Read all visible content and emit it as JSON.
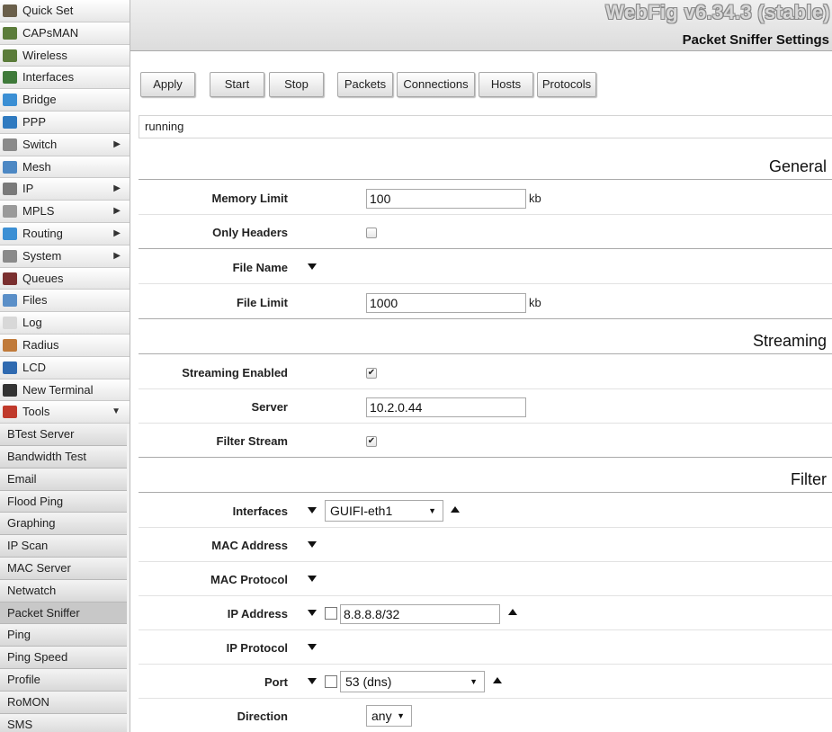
{
  "sidebar": {
    "items": [
      {
        "label": "Quick Set",
        "icon": "quick-set-icon",
        "color": "#6a5f4a",
        "arrow": ""
      },
      {
        "label": "CAPsMAN",
        "icon": "antenna-icon",
        "color": "#5b7c3a",
        "arrow": ""
      },
      {
        "label": "Wireless",
        "icon": "antenna-icon",
        "color": "#5b7c3a",
        "arrow": ""
      },
      {
        "label": "Interfaces",
        "icon": "interfaces-icon",
        "color": "#3f7a3a",
        "arrow": ""
      },
      {
        "label": "Bridge",
        "icon": "bridge-icon",
        "color": "#3b8fd4",
        "arrow": ""
      },
      {
        "label": "PPP",
        "icon": "ppp-icon",
        "color": "#2f7ac0",
        "arrow": ""
      },
      {
        "label": "Switch",
        "icon": "switch-icon",
        "color": "#8a8a8a",
        "arrow": "▶"
      },
      {
        "label": "Mesh",
        "icon": "mesh-icon",
        "color": "#4d88c4",
        "arrow": ""
      },
      {
        "label": "IP",
        "icon": "ip-icon",
        "color": "#7a7a7a",
        "arrow": "▶"
      },
      {
        "label": "MPLS",
        "icon": "mpls-icon",
        "color": "#9a9a9a",
        "arrow": "▶"
      },
      {
        "label": "Routing",
        "icon": "routing-icon",
        "color": "#3b8fd4",
        "arrow": "▶"
      },
      {
        "label": "System",
        "icon": "gear-icon",
        "color": "#8a8a8a",
        "arrow": "▶"
      },
      {
        "label": "Queues",
        "icon": "queues-icon",
        "color": "#7a2f2f",
        "arrow": ""
      },
      {
        "label": "Files",
        "icon": "folder-icon",
        "color": "#5a8fc8",
        "arrow": ""
      },
      {
        "label": "Log",
        "icon": "log-icon",
        "color": "#d8d8d8",
        "arrow": ""
      },
      {
        "label": "Radius",
        "icon": "radius-icon",
        "color": "#c07a3a",
        "arrow": ""
      },
      {
        "label": "LCD",
        "icon": "monitor-icon",
        "color": "#2f6ab0",
        "arrow": ""
      },
      {
        "label": "New Terminal",
        "icon": "terminal-icon",
        "color": "#333333",
        "arrow": ""
      },
      {
        "label": "Tools",
        "icon": "tools-icon",
        "color": "#c0392b",
        "arrow": "▼"
      }
    ],
    "tools_submenu": [
      {
        "label": "BTest Server",
        "active": false
      },
      {
        "label": "Bandwidth Test",
        "active": false
      },
      {
        "label": "Email",
        "active": false
      },
      {
        "label": "Flood Ping",
        "active": false
      },
      {
        "label": "Graphing",
        "active": false
      },
      {
        "label": "IP Scan",
        "active": false
      },
      {
        "label": "MAC Server",
        "active": false
      },
      {
        "label": "Netwatch",
        "active": false
      },
      {
        "label": "Packet Sniffer",
        "active": true
      },
      {
        "label": "Ping",
        "active": false
      },
      {
        "label": "Ping Speed",
        "active": false
      },
      {
        "label": "Profile",
        "active": false
      },
      {
        "label": "RoMON",
        "active": false
      },
      {
        "label": "SMS",
        "active": false
      }
    ]
  },
  "header": {
    "brand": "WebFig v6.34.3 (stable)",
    "page_title": "Packet Sniffer Settings"
  },
  "toolbar": {
    "apply": "Apply",
    "start": "Start",
    "stop": "Stop",
    "packets": "Packets",
    "connections": "Connections",
    "hosts": "Hosts",
    "protocols": "Protocols"
  },
  "status": "running",
  "sections": {
    "general": "General",
    "streaming": "Streaming",
    "filter": "Filter"
  },
  "form": {
    "memory_limit": {
      "label": "Memory Limit",
      "value": "100",
      "unit": "kb"
    },
    "only_headers": {
      "label": "Only Headers",
      "checked": false
    },
    "file_name": {
      "label": "File Name"
    },
    "file_limit": {
      "label": "File Limit",
      "value": "1000",
      "unit": "kb"
    },
    "streaming_enabled": {
      "label": "Streaming Enabled",
      "checked": true,
      "mark": "✔"
    },
    "server": {
      "label": "Server",
      "value": "10.2.0.44"
    },
    "filter_stream": {
      "label": "Filter Stream",
      "checked": true,
      "mark": "✔"
    },
    "interfaces": {
      "label": "Interfaces",
      "value": "GUIFI-eth1"
    },
    "mac_address": {
      "label": "MAC Address"
    },
    "mac_protocol": {
      "label": "MAC Protocol"
    },
    "ip_address": {
      "label": "IP Address",
      "value": "8.8.8.8/32"
    },
    "ip_protocol": {
      "label": "IP Protocol"
    },
    "port": {
      "label": "Port",
      "value": "53 (dns)"
    },
    "direction": {
      "label": "Direction",
      "value": "any"
    }
  }
}
